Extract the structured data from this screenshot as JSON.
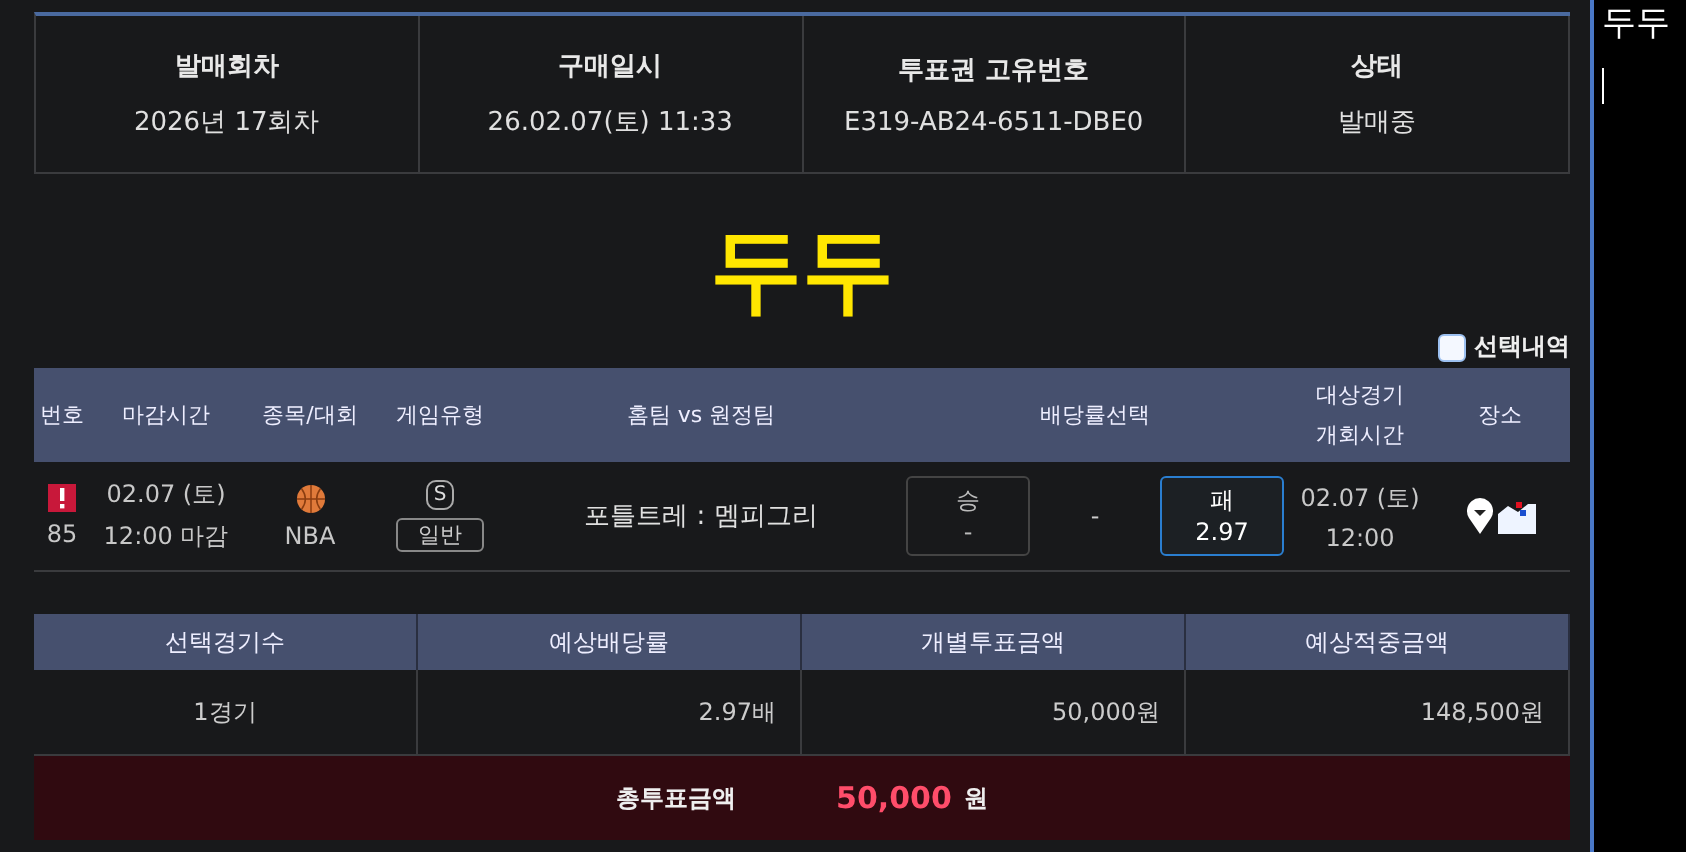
{
  "info": [
    {
      "label": "발매회차",
      "value": "2026년 17회차"
    },
    {
      "label": "구매일시",
      "value": "26.02.07(토) 11:33"
    },
    {
      "label": "투표권 고유번호",
      "value": "E319-AB24-6511-DBE0"
    },
    {
      "label": "상태",
      "value": "발매중"
    }
  ],
  "handwriting": "두두",
  "selection_toggle": {
    "label": "선택내역",
    "checked": false
  },
  "games": {
    "columns": [
      "번호",
      "마감시간",
      "종목/대회",
      "게임유형",
      "홈팀 vs 원정팀",
      "배당률선택",
      "대상경기\n개회시간",
      "장소"
    ],
    "rows": [
      {
        "number": "85",
        "deadline_date": "02.07 (토)",
        "deadline_time": "12:00 마감",
        "sport": "NBA",
        "game_badge": "S",
        "game_type": "일반",
        "teams": "포틀트레 : 멤피그리",
        "odds": [
          {
            "kind": "button",
            "label": "승",
            "value": "-",
            "selected": false
          },
          {
            "kind": "plain",
            "label": "-"
          },
          {
            "kind": "button",
            "label": "패",
            "value": "2.97",
            "selected": true
          }
        ],
        "match_date": "02.07 (토)",
        "match_time": "12:00"
      }
    ]
  },
  "summary": {
    "columns": [
      "선택경기수",
      "예상배당률",
      "개별투표금액",
      "예상적중금액"
    ],
    "values": [
      "1경기",
      "2.97배",
      "50,000원",
      "148,500원"
    ]
  },
  "total": {
    "label": "총투표금액",
    "amount": "50,000",
    "unit": "원"
  },
  "side_panel": {
    "text": "두두"
  }
}
